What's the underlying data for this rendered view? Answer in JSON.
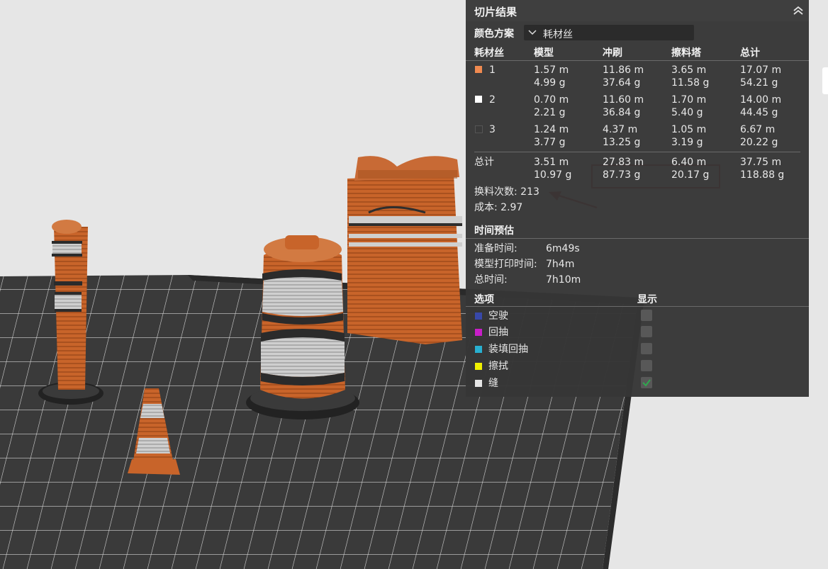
{
  "panel": {
    "title": "切片结果",
    "color_scheme_label": "颜色方案",
    "color_scheme_value": "耗材丝",
    "headers": [
      "耗材丝",
      "模型",
      "冲刷",
      "擦料塔",
      "总计"
    ],
    "rows": [
      {
        "id": "1",
        "color": "#f08a50",
        "model": [
          "1.57 m",
          "4.99 g"
        ],
        "flush": [
          "11.86 m",
          "37.64 g"
        ],
        "tower": [
          "3.65 m",
          "11.58 g"
        ],
        "total": [
          "17.07 m",
          "54.21 g"
        ]
      },
      {
        "id": "2",
        "color": "#ffffff",
        "model": [
          "0.70 m",
          "2.21 g"
        ],
        "flush": [
          "11.60 m",
          "36.84 g"
        ],
        "tower": [
          "1.70 m",
          "5.40 g"
        ],
        "total": [
          "14.00 m",
          "44.45 g"
        ]
      },
      {
        "id": "3",
        "color": "#3a3a3a",
        "model": [
          "1.24 m",
          "3.77 g"
        ],
        "flush": [
          "4.37 m",
          "13.25 g"
        ],
        "tower": [
          "1.05 m",
          "3.19 g"
        ],
        "total": [
          "6.67 m",
          "20.22 g"
        ]
      }
    ],
    "total_row": {
      "label": "总计",
      "model": [
        "3.51 m",
        "10.97 g"
      ],
      "flush": [
        "27.83 m",
        "87.73 g"
      ],
      "tower": [
        "6.40 m",
        "20.17 g"
      ],
      "total": [
        "37.75 m",
        "118.88 g"
      ]
    },
    "filament_changes": "换料次数: 213",
    "cost": "成本: 2.97",
    "time_header": "时间预估",
    "times": [
      {
        "label": "准备时间:",
        "value": "6m49s"
      },
      {
        "label": "模型打印时间:",
        "value": "7h4m"
      },
      {
        "label": "总时间:",
        "value": "7h10m"
      }
    ],
    "options_header": "选项",
    "display_header": "显示",
    "options": [
      {
        "label": "空驶",
        "color": "#3848a8",
        "checked": false
      },
      {
        "label": "回抽",
        "color": "#c81ec8",
        "checked": false
      },
      {
        "label": "装填回抽",
        "color": "#28b0d0",
        "checked": false
      },
      {
        "label": "擦拭",
        "color": "#f0f000",
        "checked": false
      },
      {
        "label": "缝",
        "color": "#e6e6e6",
        "checked": true
      }
    ]
  },
  "colors": {
    "accent_orange": "#c8642a",
    "bed": "#3a3a3a",
    "annotation_red": "#e01818",
    "check_green": "#2fa84f"
  }
}
